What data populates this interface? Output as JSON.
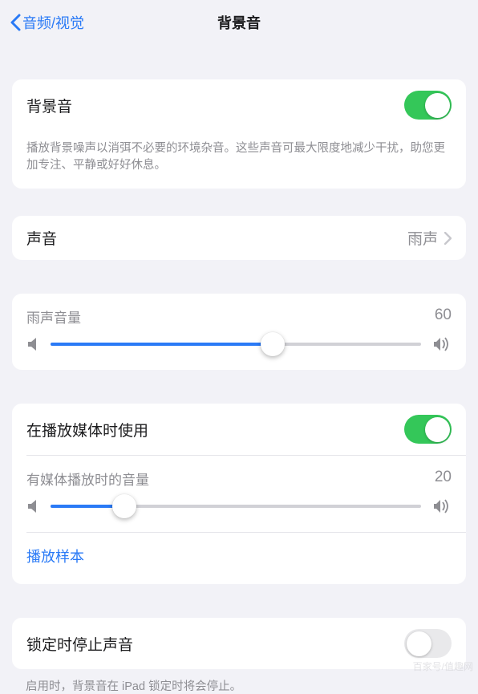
{
  "nav": {
    "back_label": "音频/视觉",
    "title": "背景音"
  },
  "bg_sound": {
    "title": "背景音",
    "on": true,
    "desc": "播放背景噪声以消弭不必要的环境杂音。这些声音可最大限度地减少干扰，助您更加专注、平静或好好休息。"
  },
  "sound_select": {
    "label": "声音",
    "value": "雨声"
  },
  "sound_volume": {
    "label": "雨声音量",
    "value": 60
  },
  "media": {
    "use_with_media_label": "在播放媒体时使用",
    "use_with_media_on": true,
    "media_volume_label": "有媒体播放时的音量",
    "media_volume_value": 20,
    "play_sample_label": "播放样本"
  },
  "lock": {
    "label": "锁定时停止声音",
    "on": false,
    "footer": "启用时，背景音在 iPad 锁定时将会停止。"
  },
  "watermark": "百家号/值趣网"
}
